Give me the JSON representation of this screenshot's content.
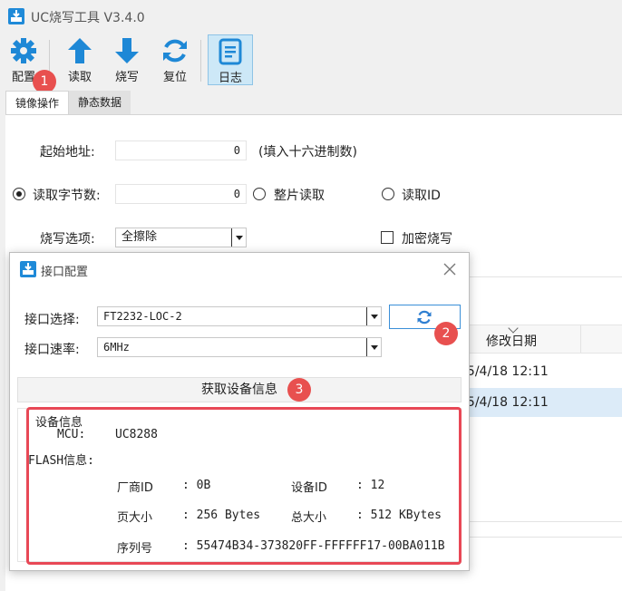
{
  "window": {
    "title": "UC烧写工具 V3.4.0"
  },
  "toolbar": {
    "config": {
      "label": "配置",
      "icon": "gear-icon"
    },
    "read": {
      "label": "读取",
      "icon": "arrow-up-icon"
    },
    "burn": {
      "label": "烧写",
      "icon": "arrow-down-icon"
    },
    "reset": {
      "label": "复位",
      "icon": "refresh-icon"
    },
    "log": {
      "label": "日志",
      "icon": "log-icon"
    }
  },
  "tabs": [
    {
      "label": "镜像操作",
      "active": true
    },
    {
      "label": "静态数据",
      "active": false
    }
  ],
  "form": {
    "start_address": {
      "label": "起始地址:",
      "value": "0",
      "hint": "(填入十六进制数)"
    },
    "read_bytes": {
      "label": "读取字节数:",
      "value": "0",
      "selected": true
    },
    "full_chip_read": {
      "label": "整片读取",
      "selected": false
    },
    "read_id": {
      "label": "读取ID",
      "selected": false
    },
    "burn_option": {
      "label": "烧写选项:",
      "value": "全擦除"
    },
    "encrypt_burn": {
      "label": "加密烧写",
      "checked": false
    }
  },
  "file_list": {
    "column_header": "修改日期",
    "rows": [
      "25/4/18 12:11",
      "25/4/18 12:11"
    ]
  },
  "dialog": {
    "title": "接口配置",
    "port_select": {
      "label": "接口选择:",
      "value": "FT2232-LOC-2"
    },
    "port_speed": {
      "label": "接口速率:",
      "value": "6MHz"
    },
    "get_info_button": "获取设备信息",
    "device_info": {
      "section_title": "设备信息",
      "mcu_label": "MCU:",
      "mcu_value": "UC8288",
      "flash_label": "FLASH信息:",
      "vendor_id_label": "厂商ID",
      "vendor_id_value": ": 0B",
      "device_id_label": "设备ID",
      "device_id_value": ": 12",
      "page_size_label": "页大小",
      "page_size_value": ": 256 Bytes",
      "total_size_label": "总大小",
      "total_size_value": ": 512 KBytes",
      "serial_label": "序列号",
      "serial_value": ": 55474B34-373820FF-FFFFFF17-00BA011B"
    }
  },
  "annotations": {
    "badge_1": "1",
    "badge_2": "2",
    "badge_3": "3"
  },
  "colors": {
    "accent": "#1e88d6",
    "annotation_red": "#e84856",
    "badge_red": "#e8504f"
  }
}
